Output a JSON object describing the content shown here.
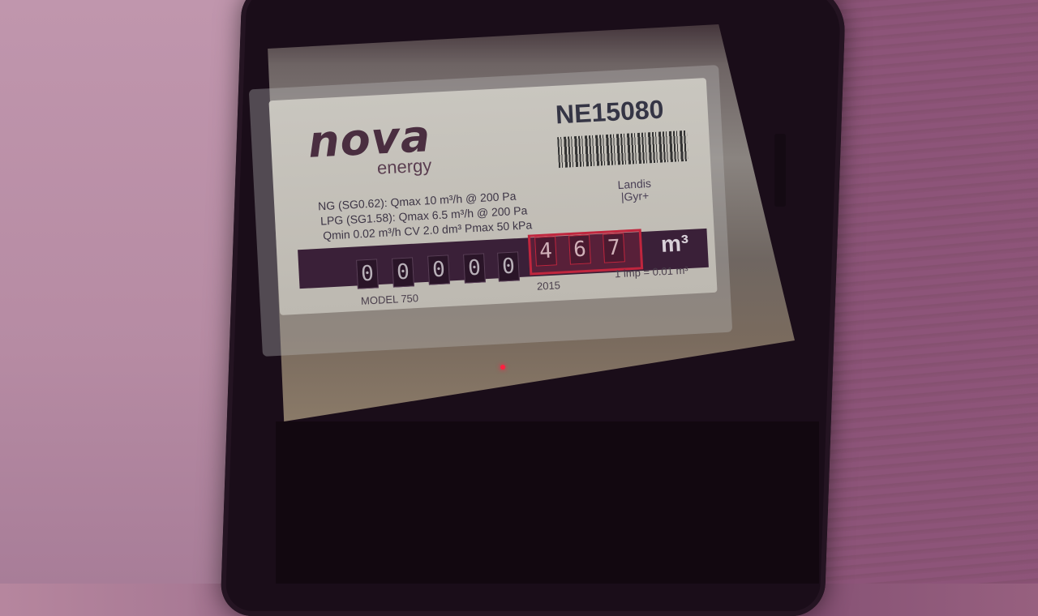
{
  "meter": {
    "brand": "nova",
    "brand_sub": "energy",
    "serial": "NE15080",
    "spec_line_1": "NG (SG0.62):   Qmax 10 m³/h  @ 200 Pa",
    "spec_line_2": "LPG (SG1.58): Qmax 6.5 m³/h @ 200 Pa",
    "spec_line_3": "Qmin 0.02 m³/h  CV 2.0 dm³  Pmax 50 kPa",
    "maker_1": "Landis",
    "maker_2": "|Gyr+",
    "digits": [
      "0",
      "0",
      "0",
      "0",
      "0",
      "4",
      "6",
      "7"
    ],
    "unit": "m³",
    "model": "MODEL 750",
    "year": "2015",
    "impulse": "1 imp = 0.01 m³"
  },
  "colors": {
    "highlight": "#c0263e",
    "led": "#ff2040"
  }
}
